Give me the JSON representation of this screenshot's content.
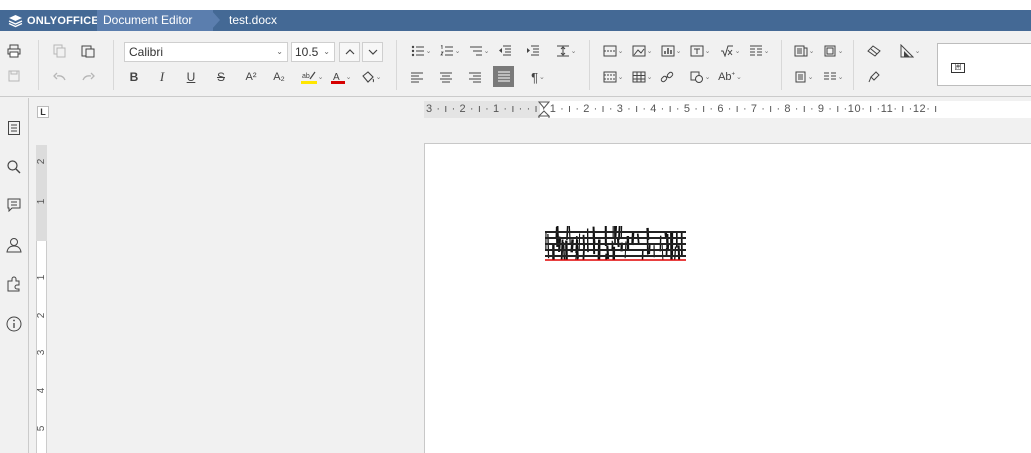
{
  "app": {
    "brand": "ONLYOFFICE",
    "editor_name": "Document Editor",
    "document_title": "test.docx"
  },
  "toolbar": {
    "font_name": "Calibri",
    "font_size": "10.5"
  },
  "ruler": {
    "horizontal_labels": "3 · ı · 2 · ı · 1 · ı ·   · ı · 1 · ı · 2 · ı · 3 · ı · 4 · ı · 5 · ı · 6 · ı · 7 · ı · 8 · ı · 9 · ı ·10· ı ·11· ı ·12· ı",
    "vertical_labels": [
      "2",
      "1",
      "1",
      "2",
      "3",
      "4",
      "5"
    ]
  },
  "styles_thumb_label": "囲",
  "colors": {
    "titlebar": "#446995",
    "tab_bg": "#5b7eae",
    "highlight_yellow": "#ffe600",
    "font_color_red": "#d60000",
    "garbled_underline": "#e00000"
  },
  "icons": {
    "left_panel": [
      "navigation-icon",
      "search-icon",
      "comments-icon",
      "users-icon",
      "plugins-icon",
      "about-icon"
    ]
  }
}
